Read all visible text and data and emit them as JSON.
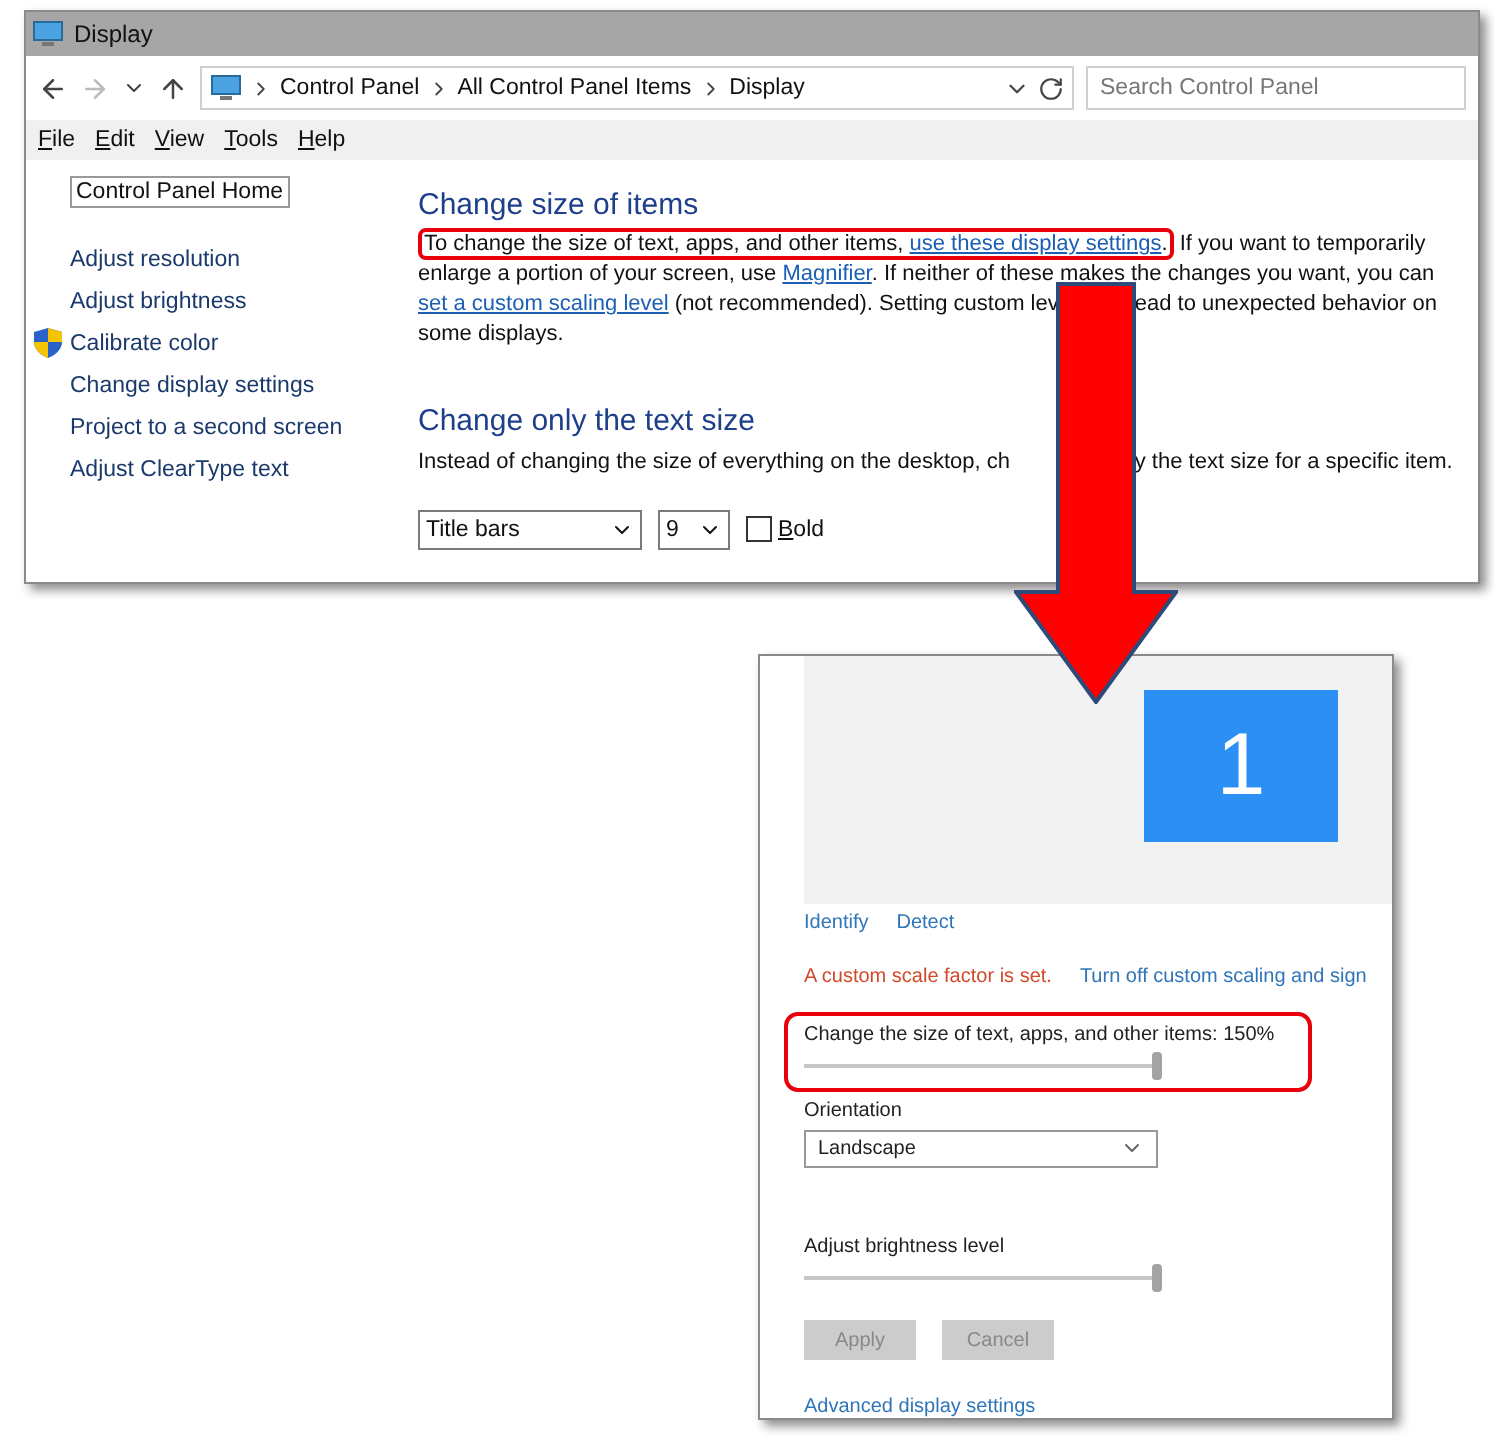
{
  "window": {
    "title": "Display"
  },
  "address_bar": {
    "path": [
      "Control Panel",
      "All Control Panel Items",
      "Display"
    ]
  },
  "search": {
    "placeholder": "Search Control Panel"
  },
  "menu": [
    "File",
    "Edit",
    "View",
    "Tools",
    "Help"
  ],
  "sidebar": {
    "home": "Control Panel Home",
    "items": [
      {
        "label": "Adjust resolution",
        "shield": false
      },
      {
        "label": "Adjust brightness",
        "shield": false
      },
      {
        "label": "Calibrate color",
        "shield": true
      },
      {
        "label": "Change display settings",
        "shield": false
      },
      {
        "label": "Project to a second screen",
        "shield": false
      },
      {
        "label": "Adjust ClearType text",
        "shield": false
      }
    ]
  },
  "sections": [
    {
      "heading": "Change size of items",
      "runs": [
        {
          "kind": "highlight",
          "runs": [
            {
              "kind": "plain",
              "text": "To change the size of text, apps, and other items, "
            },
            {
              "kind": "link",
              "text": "use these display settings"
            },
            {
              "kind": "plain",
              "text": "."
            }
          ]
        },
        {
          "kind": "plain",
          "text": "  If you want to temporarily enlarge a portion of your screen, use "
        },
        {
          "kind": "link",
          "text": "Magnifier"
        },
        {
          "kind": "plain",
          "text": ".  If neither of these makes the changes you want, you can "
        },
        {
          "kind": "link",
          "text": "set a custom scaling level"
        },
        {
          "kind": "plain",
          "text": " (not recommended).  Setting custom lev"
        },
        {
          "kind": "covered"
        },
        {
          "kind": "plain",
          "text": "ead to unexpected behavior on some displays."
        }
      ]
    },
    {
      "heading": "Change only the text size",
      "runs": [
        {
          "kind": "plain",
          "text": "Instead of changing the size of everything on the desktop, ch"
        },
        {
          "kind": "covered"
        },
        {
          "kind": "plain",
          "text": "y the text size for a specific item."
        }
      ]
    }
  ],
  "text_size_controls": {
    "item": "Title bars",
    "size": "9",
    "bold": {
      "label": "Bold",
      "checked": false
    }
  },
  "settings_panel": {
    "monitor": "1",
    "links": [
      "Identify",
      "Detect"
    ],
    "scale_warning": "A custom scale factor is set.",
    "scale_link": "Turn off custom scaling and sign",
    "scale_slider": {
      "label": "Change the size of text, apps, and other items: 150%",
      "level": 0.98,
      "highlighted": true
    },
    "orientation": {
      "label": "Orientation",
      "value": "Landscape"
    },
    "brightness_slider": {
      "label": "Adjust brightness level",
      "level": 0.98,
      "highlighted": false
    },
    "buttons": [
      {
        "label": "Apply",
        "disabled": true
      },
      {
        "label": "Cancel",
        "disabled": true
      }
    ],
    "advanced_link": "Advanced display settings"
  }
}
